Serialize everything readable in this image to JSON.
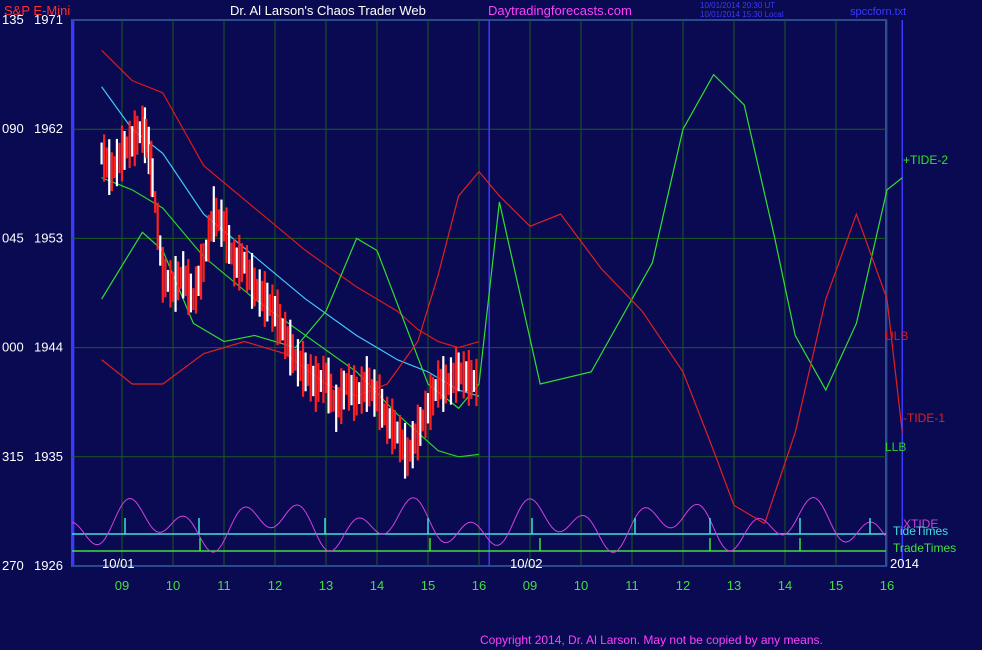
{
  "header": {
    "symbol": "S&P E-Mini",
    "title": "Dr. Al Larson's Chaos Trader Web",
    "site": "Daytradingforecasts.com",
    "timestamp_1": "10/01/2014 20:30 UT",
    "timestamp_2": "10/01/2014 15:30 Local",
    "file": "spccforn.txt"
  },
  "footer": {
    "copyright": "Copyright 2014, Dr. Al Larson. May not be copied by any means."
  },
  "colors": {
    "background": "#0a0a52",
    "frame": "#3a3aff",
    "grid": "#1c5a1c",
    "ulb": "#e01818",
    "llb": "#2ad02a",
    "tide_plus": "#30e030",
    "tide_minus": "#e02020",
    "xtide": "#d040e0",
    "tide_times": "#40e0e0",
    "trade_times": "#40e040",
    "cyan_band": "#40c8ff",
    "yellow_line": "#ffff30",
    "time_labels": "#40e040",
    "header_red": "#ff3030",
    "header_magenta": "#ff40ff",
    "header_blue": "#3a3aff"
  },
  "chart_data": {
    "type": "line",
    "title": "S&P E-Mini",
    "x_hours": [
      9,
      10,
      11,
      12,
      13,
      14,
      15,
      16,
      9,
      10,
      11,
      12,
      13,
      14,
      15,
      16
    ],
    "x_date_labels": [
      {
        "label": "10/01",
        "at": 0
      },
      {
        "label": "10/02",
        "at": 8
      }
    ],
    "year_label": "2014",
    "x_range": [
      -0.4,
      15.3
    ],
    "y_range": [
      1926,
      1971
    ],
    "y_ticks": [
      {
        "value": 1971,
        "left": "135",
        "right": "1971"
      },
      {
        "value": 1962,
        "left": "090",
        "right": "1962"
      },
      {
        "value": 1953,
        "left": "045",
        "right": "1953"
      },
      {
        "value": 1944,
        "left": "000",
        "right": "1944"
      },
      {
        "value": 1935,
        "left": "315",
        "right": "1935"
      },
      {
        "value": 1926,
        "left": "270",
        "right": "1926"
      }
    ],
    "grid": true,
    "price_bars": {
      "name": "S&P E-Mini 10/01",
      "x": [
        -0.4,
        -0.2,
        0.0,
        0.2,
        0.4,
        0.5,
        0.6,
        0.8,
        1.0,
        1.2,
        1.4,
        1.6,
        1.8,
        2.0,
        2.2,
        2.4,
        2.6,
        2.8,
        3.0,
        3.2,
        3.4,
        3.6,
        3.8,
        4.0,
        4.2,
        4.4,
        4.6,
        4.8,
        5.0,
        5.2,
        5.4,
        5.6,
        5.8,
        6.0,
        6.2,
        6.4,
        6.6,
        6.8,
        7.0
      ],
      "close": [
        1960,
        1958.5,
        1960,
        1961,
        1962,
        1961,
        1958,
        1950,
        1949,
        1950,
        1948,
        1951,
        1955,
        1954,
        1951,
        1951,
        1949,
        1948,
        1947,
        1945,
        1943,
        1942,
        1941,
        1941.5,
        1939,
        1941,
        1940,
        1941,
        1940,
        1938,
        1937,
        1935,
        1937,
        1939,
        1941,
        1941,
        1942,
        1941.5,
        1941
      ]
    },
    "series": [
      {
        "name": "ULB",
        "x": [
          -0.4,
          0.2,
          0.8,
          1.6,
          2.6,
          3.6,
          4.6,
          5.4,
          5.8,
          6.2,
          6.6,
          7.0
        ],
        "y": [
          1968.5,
          1966,
          1965,
          1959,
          1955.5,
          1952,
          1949,
          1947,
          1945.5,
          1944.5,
          1944,
          1944.5
        ]
      },
      {
        "name": "LLB",
        "x": [
          -0.4,
          0.2,
          0.8,
          1.6,
          2.6,
          3.6,
          4.6,
          5.4,
          5.8,
          6.2,
          6.6,
          7.0
        ],
        "y": [
          1958,
          1957,
          1955.5,
          1951.5,
          1948,
          1945,
          1942,
          1938.5,
          1937,
          1935.5,
          1935,
          1935.2
        ]
      },
      {
        "name": "Cyan band",
        "x": [
          -0.4,
          0.2,
          0.8,
          1.6,
          2.6,
          3.6,
          4.6,
          5.4,
          6.0,
          6.6,
          7.0
        ],
        "y": [
          1965.5,
          1962,
          1960,
          1955,
          1951.5,
          1948,
          1945,
          1943,
          1942,
          1940.5,
          1940
        ]
      },
      {
        "name": "+TIDE-2",
        "x": [
          -0.4,
          0.4,
          0.8,
          1.4,
          2.0,
          2.6,
          3.4,
          4.0,
          4.6,
          5.0,
          6.0,
          6.6,
          7.0,
          7.4,
          8.2,
          9.2,
          10.4,
          11.0,
          11.6,
          12.2,
          12.8,
          13.2,
          13.8,
          14.4,
          15.0,
          15.3
        ],
        "y": [
          1948,
          1953.5,
          1952,
          1946,
          1944.5,
          1945,
          1944,
          1947,
          1953,
          1952,
          1941,
          1939,
          1941,
          1956,
          1941,
          1942,
          1951,
          1962,
          1966.5,
          1964,
          1953,
          1945,
          1940.5,
          1946,
          1957,
          1958
        ]
      },
      {
        "name": "-TIDE-1",
        "x": [
          -0.4,
          0.2,
          0.8,
          1.6,
          2.4,
          3.2,
          4.0,
          4.6,
          5.2,
          5.8,
          6.2,
          6.6,
          7.0,
          7.4,
          8.0,
          8.6,
          9.4,
          10.2,
          11.0,
          11.6,
          12.0,
          12.6,
          13.2,
          13.8,
          14.4,
          15.0,
          15.3
        ],
        "y": [
          1943,
          1941,
          1941,
          1943.5,
          1944.5,
          1943.5,
          1941,
          1940,
          1941,
          1944.5,
          1950,
          1956.5,
          1958.5,
          1956.5,
          1954,
          1955,
          1950.5,
          1947,
          1942,
          1935.5,
          1931,
          1929.5,
          1937,
          1948,
          1955,
          1948,
          1937
        ]
      }
    ],
    "x_bounds_labels": {
      "ulb": "ULB",
      "llb": "LLB",
      "tide2": "+TIDE-2",
      "tide1": "-TIDE-1",
      "xtide": "XTIDE",
      "tide_times": "TideTimes",
      "trade_times": "TradeTimes"
    }
  }
}
